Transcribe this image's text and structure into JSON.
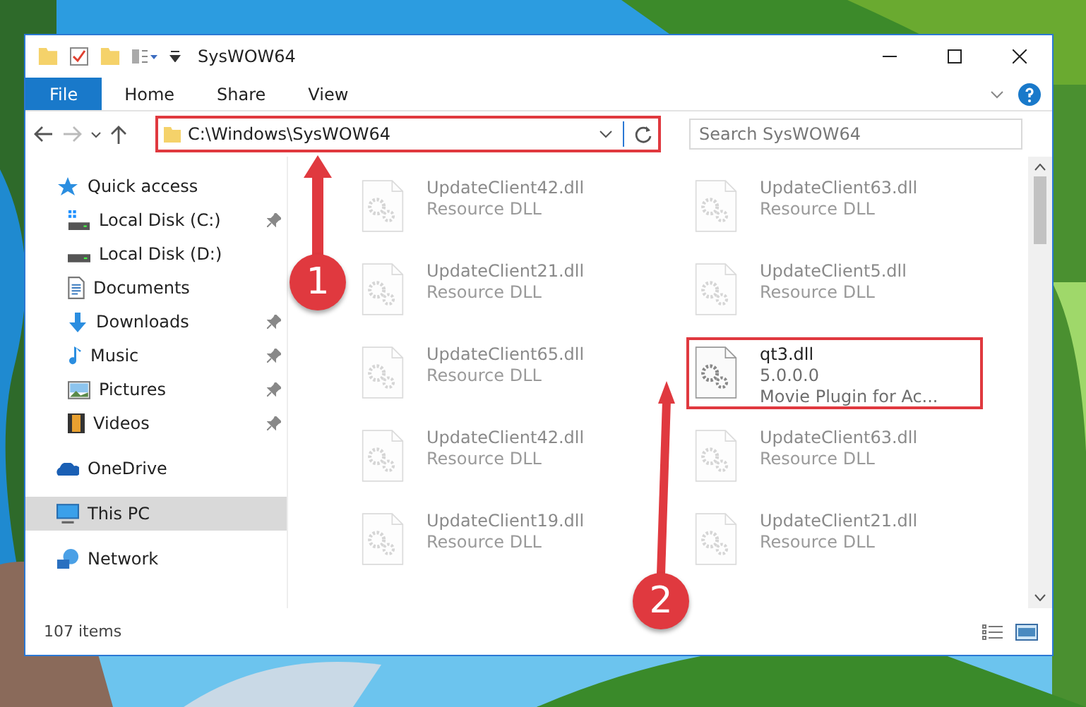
{
  "window": {
    "title": "SysWOW64"
  },
  "ribbon_tabs": [
    {
      "label": "File",
      "selected": true
    },
    {
      "label": "Home",
      "selected": false
    },
    {
      "label": "Share",
      "selected": false
    },
    {
      "label": "View",
      "selected": false
    }
  ],
  "address_bar": {
    "path": "C:\\Windows\\SysWOW64",
    "outlined": true
  },
  "search": {
    "placeholder": "Search SysWOW64"
  },
  "sidebar": {
    "items": [
      {
        "label": "Quick access",
        "kind": "star",
        "selected": false,
        "children": [
          {
            "label": "Local Disk (C:)",
            "kind": "winDrive",
            "pinned": true,
            "selected": false
          },
          {
            "label": "Local Disk (D:)",
            "kind": "drive",
            "pinned": false,
            "selected": false
          },
          {
            "label": "Documents",
            "kind": "document",
            "pinned": false,
            "selected": false
          },
          {
            "label": "Downloads",
            "kind": "download",
            "pinned": true,
            "selected": false
          },
          {
            "label": "Music",
            "kind": "music",
            "pinned": true,
            "selected": false
          },
          {
            "label": "Pictures",
            "kind": "pictures",
            "pinned": true,
            "selected": false
          },
          {
            "label": "Videos",
            "kind": "videos",
            "pinned": true,
            "selected": false
          }
        ]
      },
      {
        "label": "OneDrive",
        "kind": "cloud",
        "selected": false
      },
      {
        "label": "This PC",
        "kind": "pc",
        "selected": true
      },
      {
        "label": "Network",
        "kind": "network",
        "selected": false
      }
    ]
  },
  "files": [
    {
      "name": "UpdateClient42.dll",
      "detail": [
        "Resource DLL"
      ],
      "blurred": true,
      "outlined": false
    },
    {
      "name": "UpdateClient63.dll",
      "detail": [
        "Resource DLL"
      ],
      "blurred": true,
      "outlined": false
    },
    {
      "name": "UpdateClient21.dll",
      "detail": [
        "Resource DLL"
      ],
      "blurred": true,
      "outlined": false
    },
    {
      "name": "UpdateClient5.dll",
      "detail": [
        "Resource DLL"
      ],
      "blurred": true,
      "outlined": false
    },
    {
      "name": "UpdateClient65.dll",
      "detail": [
        "Resource DLL"
      ],
      "blurred": true,
      "outlined": false
    },
    {
      "name": "qt3.dll",
      "detail": [
        "5.0.0.0",
        "Movie Plugin for Ac..."
      ],
      "blurred": false,
      "outlined": true
    },
    {
      "name": "UpdateClient42.dll",
      "detail": [
        "Resource DLL"
      ],
      "blurred": true,
      "outlined": false
    },
    {
      "name": "UpdateClient63.dll",
      "detail": [
        "Resource DLL"
      ],
      "blurred": true,
      "outlined": false
    },
    {
      "name": "UpdateClient19.dll",
      "detail": [
        "Resource DLL"
      ],
      "blurred": true,
      "outlined": false
    },
    {
      "name": "UpdateClient21.dll",
      "detail": [
        "Resource DLL"
      ],
      "blurred": true,
      "outlined": false
    }
  ],
  "status_bar": {
    "count": "107 items"
  },
  "annotations": [
    {
      "number": "1"
    },
    {
      "number": "2"
    }
  ]
}
